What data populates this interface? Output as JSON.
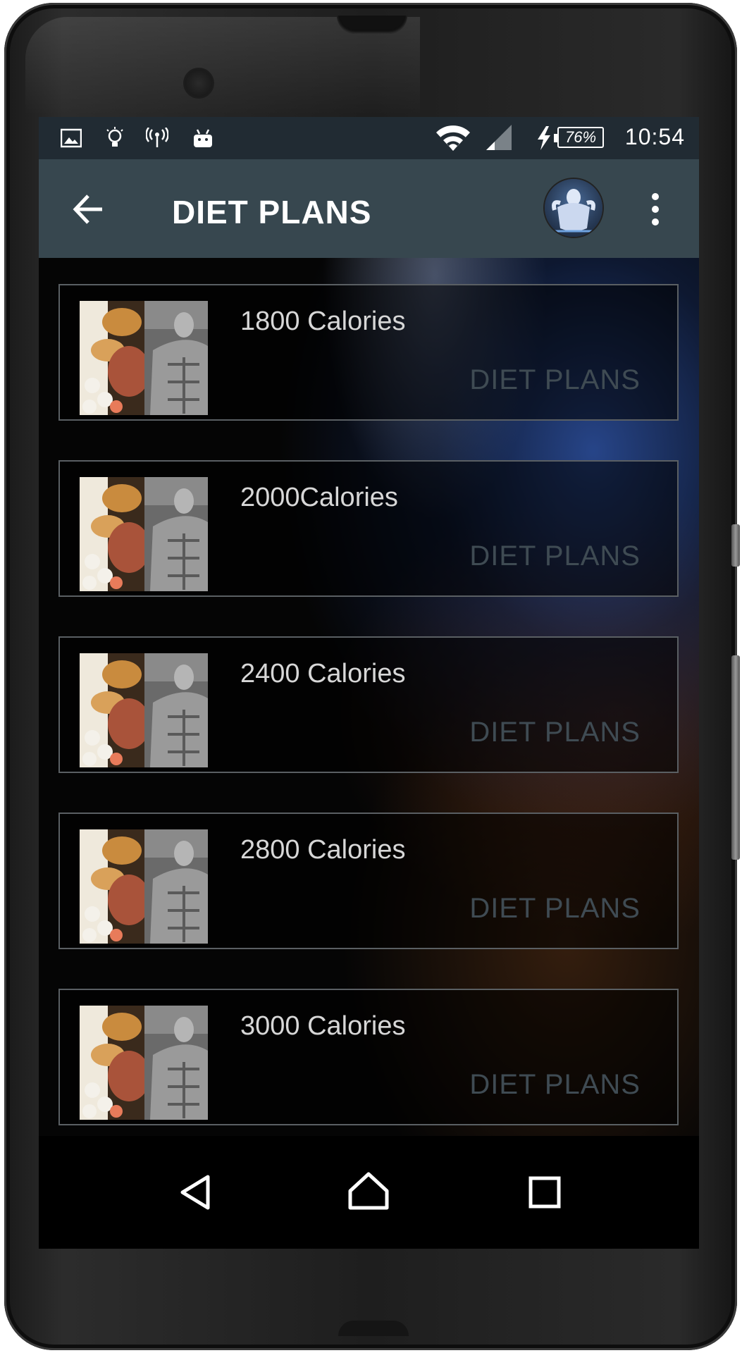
{
  "status_bar": {
    "time": "10:54",
    "battery_percent": "76%",
    "icons": [
      "gallery-icon",
      "lightbulb-icon",
      "hotspot-icon",
      "android-icon",
      "wifi-icon",
      "signal-icon",
      "charging-icon"
    ]
  },
  "app_bar": {
    "title": "DIET PLANS",
    "back_icon": "arrow-back-icon",
    "avatar_icon": "bodybuilder-avatar",
    "menu_icon": "more-vert-icon"
  },
  "plans": [
    {
      "title": "1800 Calories",
      "subtitle": "DIET PLANS"
    },
    {
      "title": "2000Calories",
      "subtitle": "DIET PLANS"
    },
    {
      "title": "2400 Calories",
      "subtitle": "DIET PLANS"
    },
    {
      "title": "2800 Calories",
      "subtitle": "DIET PLANS"
    },
    {
      "title": "3000 Calories",
      "subtitle": "DIET PLANS"
    }
  ],
  "nav_bar": {
    "buttons": [
      "back-nav-icon",
      "home-nav-icon",
      "recents-nav-icon"
    ]
  },
  "colors": {
    "status_bar": "#212b33",
    "app_bar": "#37474f",
    "card_border": "#5a5f63",
    "card_title": "#d7d7d7",
    "card_subtitle": "#3f4b53"
  }
}
